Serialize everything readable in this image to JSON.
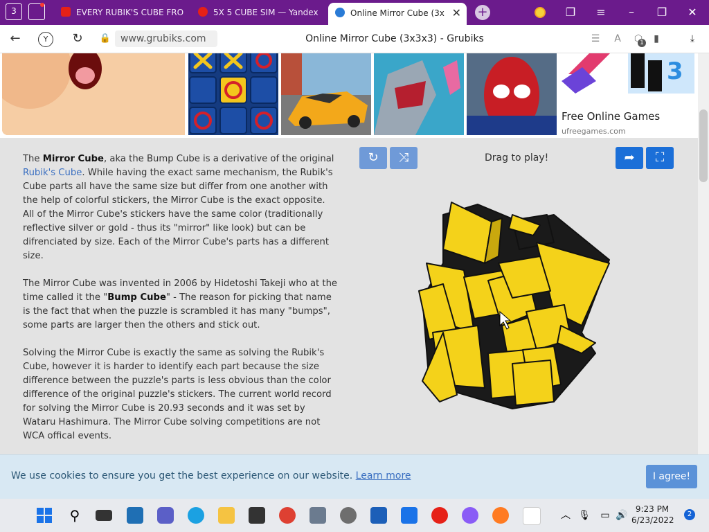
{
  "browser": {
    "tab_count": "3",
    "tabs": [
      {
        "title": "EVERY RUBIK'S CUBE FRO",
        "favicon_color": "#e62117",
        "favicon": "youtube-icon"
      },
      {
        "title": "5X 5 CUBE SIM — Yandex",
        "favicon_color": "#e62117",
        "favicon": "yandex-icon"
      },
      {
        "title": "Online Mirror Cube (3x",
        "favicon_color": "#2a7bd6",
        "favicon": "globe-icon"
      }
    ],
    "url": "www.grubiks.com",
    "page_title": "Online Mirror Cube (3x3x3) - Grubiks",
    "badge_count": "1"
  },
  "ad": {
    "title": "Free Online Games",
    "subtitle": "ufreegames.com",
    "tile_number": "3"
  },
  "article": {
    "p1_a": "The ",
    "p1_b": "Mirror Cube",
    "p1_c": ", aka the Bump Cube is a derivative of the original ",
    "p1_link": "Rubik's Cube",
    "p1_d": ". While having the exact same mechanism, the Rubik's Cube parts all have the same size but differ from one another with the help of colorful stickers, the Mirror Cube is the exact opposite. All of the Mirror Cube's stickers have the same color (traditionally reflective silver or gold - thus its \"mirror\" like look) but can be difrenciated by size. Each of the Mirror Cube's parts has a different size.",
    "p2_a": "The Mirror Cube was invented in 2006 by Hidetoshi Takeji who at the time called it the \"",
    "p2_b": "Bump Cube",
    "p2_c": "\" - The reason for picking that name is the fact that when the puzzle is scrambled it has many \"bumps\", some parts are larger then the others and stick out.",
    "p3": "Solving the Mirror Cube is exactly the same as solving the Rubik's Cube, however it is harder to identify each part because the size difference between the puzzle's parts is less obvious than the color difference of the original puzzle's stickers. The current world record for solving the Mirror Cube is 20.93 seconds and it was set by Wataru Hashimura. The Mirror Cube solving competitions are not WCA offical events."
  },
  "toolbar": {
    "drag_text": "Drag to play!"
  },
  "cookie": {
    "text": "We use cookies to ensure you get the best experience on our website. ",
    "link": "Learn more",
    "agree": "I agree!"
  },
  "taskbar": {
    "time": "9:23 PM",
    "date": "6/23/2022",
    "notifications": "2"
  },
  "colors": {
    "browser_frame": "#6b1b8c",
    "cube_yellow": "#f4d21a",
    "cube_black": "#1a1a1a",
    "button_blue": "#1b6fd8"
  }
}
